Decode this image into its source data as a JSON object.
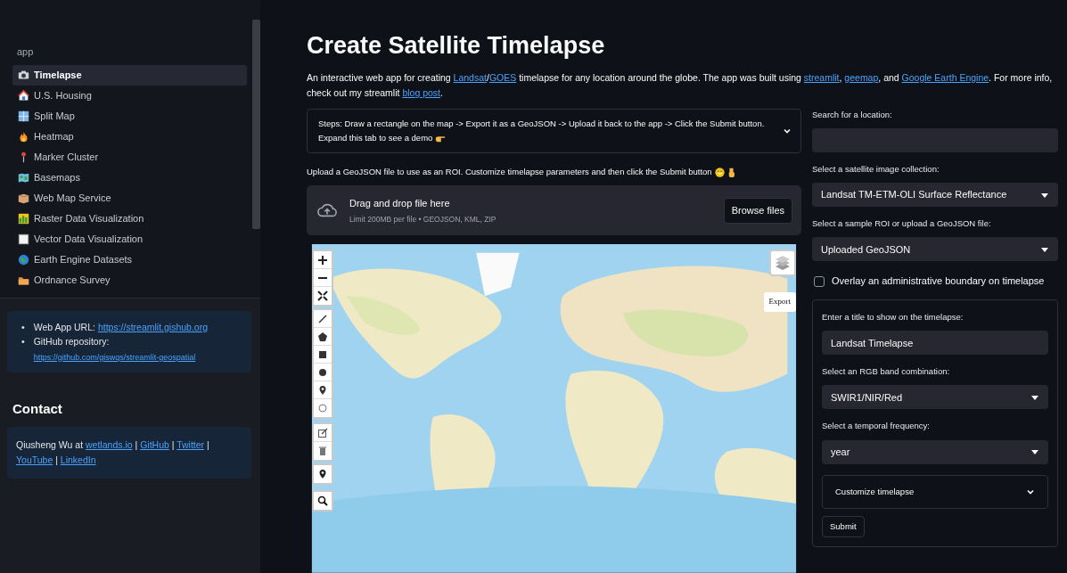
{
  "sidebar": {
    "section_label": "app",
    "nav_items": [
      {
        "label": "Timelapse",
        "selected": true
      },
      {
        "label": "U.S. Housing",
        "selected": false
      },
      {
        "label": "Split Map",
        "selected": false
      },
      {
        "label": "Heatmap",
        "selected": false
      },
      {
        "label": "Marker Cluster",
        "selected": false
      },
      {
        "label": "Basemaps",
        "selected": false
      },
      {
        "label": "Web Map Service",
        "selected": false
      },
      {
        "label": "Raster Data Visualization",
        "selected": false
      },
      {
        "label": "Vector Data Visualization",
        "selected": false
      },
      {
        "label": "Earth Engine Datasets",
        "selected": false
      },
      {
        "label": "Ordnance Survey",
        "selected": false
      }
    ],
    "info_items": [
      {
        "bullet": "•",
        "label": "Web App URL:",
        "link": "https://streamlit.gishub.org"
      },
      {
        "bullet": "•",
        "label": "GitHub repository:",
        "link": "https://github.com/giswqs/streamlit-geospatial"
      }
    ],
    "contact_heading": "Contact",
    "contact_parts": [
      {
        "text": "Qiusheng Wu at "
      },
      {
        "link": "wetlands.io"
      },
      {
        "text": " | "
      },
      {
        "link": "GitHub"
      },
      {
        "text": " | "
      },
      {
        "link": "Twitter"
      },
      {
        "text": " | "
      },
      {
        "link": "YouTube"
      },
      {
        "text": " | "
      },
      {
        "link": "LinkedIn"
      }
    ]
  },
  "main": {
    "title": "Create Satellite Timelapse",
    "description": [
      {
        "text": "An interactive web app for creating "
      },
      {
        "link": "Landsat"
      },
      {
        "text": "/"
      },
      {
        "link": "GOES"
      },
      {
        "text": " timelapse for any location around the globe. The app was built using "
      },
      {
        "link": "streamlit"
      },
      {
        "text": ", "
      },
      {
        "link": "geemap"
      },
      {
        "text": ", and "
      },
      {
        "link": "Google Earth Engine"
      },
      {
        "text": ". For more info, check out my streamlit "
      },
      {
        "link": "blog post"
      },
      {
        "text": "."
      }
    ],
    "steps_expander": {
      "label": "Steps: Draw a rectangle on the map -> Export it as a GeoJSON -> Upload it back to the app -> Click the Submit button. Expand this tab to see a demo",
      "expanded": false
    },
    "upload_caption": "Upload a GeoJSON file to use as an ROI. Customize timelapse parameters and then click the Submit button",
    "uploader": {
      "title": "Drag and drop file here",
      "limit": "Limit 200MB per file • GEOJSON, KML, ZIP",
      "button": "Browse files"
    },
    "map": {
      "export_label": "Export"
    }
  },
  "settings": {
    "search_label": "Search for a location:",
    "collection_label": "Select a satellite image collection:",
    "collection_value": "Landsat TM-ETM-OLI Surface Reflectance",
    "roi_label": "Select a sample ROI or upload a GeoJSON file:",
    "roi_value": "Uploaded GeoJSON",
    "overlay_checkbox": {
      "label": "Overlay an administrative boundary on timelapse",
      "checked": false
    },
    "form": {
      "title_label": "Enter a title to show on the timelapse:",
      "title_value": "Landsat Timelapse",
      "rgb_label": "Select an RGB band combination:",
      "rgb_value": "SWIR1/NIR/Red",
      "frequency_label": "Select a temporal frequency:",
      "frequency_value": "year",
      "customize_expander": {
        "label": "Customize timelapse",
        "expanded": false
      },
      "submit": "Submit"
    }
  }
}
